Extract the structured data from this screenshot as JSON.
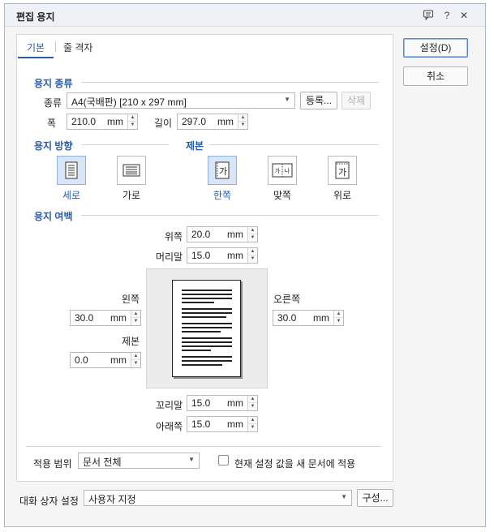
{
  "window": {
    "title": "편집 용지",
    "help_label": "?",
    "close_label": "✕",
    "feedback_icon": "speech-bubble-icon"
  },
  "tabs": [
    {
      "label": "기본",
      "active": true
    },
    {
      "label": "줄 격자",
      "active": false
    }
  ],
  "buttons": {
    "ok": "설정(D)",
    "cancel": "취소",
    "register": "등록...",
    "delete": "삭제",
    "config": "구성..."
  },
  "paper_type": {
    "section_title": "용지 종류",
    "type_label": "종류",
    "type_value": "A4(국배판) [210 x 297 mm]",
    "width_label": "폭",
    "width_value": "210.0",
    "width_unit": "mm",
    "length_label": "길이",
    "length_value": "297.0",
    "length_unit": "mm"
  },
  "orientation": {
    "section_title": "용지 방향",
    "options": [
      {
        "label": "세로",
        "selected": true,
        "icon": "portrait-page-icon"
      },
      {
        "label": "가로",
        "selected": false,
        "icon": "landscape-page-icon"
      }
    ]
  },
  "binding": {
    "section_title": "제본",
    "options": [
      {
        "label": "한쪽",
        "selected": true,
        "glyph": "가",
        "icon": "single-side-binding-icon"
      },
      {
        "label": "맞쪽",
        "selected": false,
        "glyph": "가|나",
        "icon": "facing-pages-binding-icon"
      },
      {
        "label": "위로",
        "selected": false,
        "glyph": "가",
        "icon": "top-binding-icon"
      }
    ]
  },
  "margins": {
    "section_title": "용지 여백",
    "top": {
      "label": "위쪽",
      "value": "20.0",
      "unit": "mm"
    },
    "header": {
      "label": "머리말",
      "value": "15.0",
      "unit": "mm"
    },
    "left": {
      "label": "왼쪽",
      "value": "30.0",
      "unit": "mm"
    },
    "gutter": {
      "label": "제본",
      "value": "0.0",
      "unit": "mm"
    },
    "right": {
      "label": "오른쪽",
      "value": "30.0",
      "unit": "mm"
    },
    "footer": {
      "label": "꼬리말",
      "value": "15.0",
      "unit": "mm"
    },
    "bottom": {
      "label": "아래쪽",
      "value": "15.0",
      "unit": "mm"
    }
  },
  "apply": {
    "scope_label": "적용 범위",
    "scope_value": "문서 전체",
    "checkbox_label": "현재 설정 값을 새 문서에 적용",
    "checkbox_checked": false
  },
  "dialog_settings": {
    "label": "대화 상자 설정",
    "value": "사용자 지정"
  },
  "colors": {
    "accent": "#2a5ca8",
    "selected_bg": "#d8e6f8"
  }
}
